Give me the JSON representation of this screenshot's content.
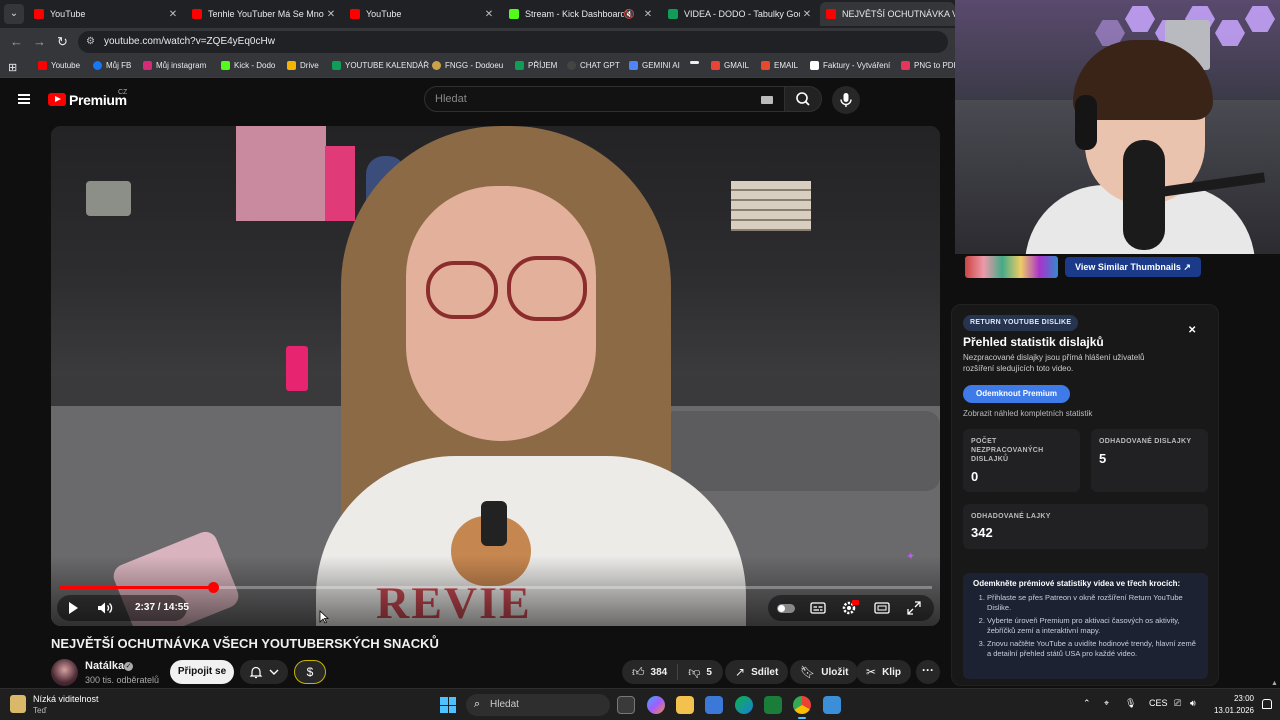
{
  "browser": {
    "tabs": [
      {
        "label": "YouTube",
        "active": false
      },
      {
        "label": "Tenhle YouTuber Má Se Mnou Problém",
        "active": false
      },
      {
        "label": "YouTube",
        "active": false
      },
      {
        "label": "Stream - Kick Dashboard",
        "active": false
      },
      {
        "label": "VIDEA - DODO - Tabulky Google",
        "active": false
      },
      {
        "label": "NEJVĚTŠÍ OCHUTNÁVKA VŠECH",
        "active": true
      }
    ],
    "url": "youtube.com/watch?v=ZQE4yEq0cHw",
    "bookmarks": [
      {
        "label": "Youtube",
        "color": "#ff0000"
      },
      {
        "label": "Můj FB",
        "color": "#1877f2"
      },
      {
        "label": "Můj instagram",
        "color": "#d62976"
      },
      {
        "label": "Kick - Dodo",
        "color": "#53fc18"
      },
      {
        "label": "Drive",
        "color": "#f4b400"
      },
      {
        "label": "YOUTUBE KALENDÁŘ",
        "color": "#0f9d58"
      },
      {
        "label": "FNGG - Dodoeu",
        "color": "#caa24a"
      },
      {
        "label": "PŘÍJEM",
        "color": "#0f9d58"
      },
      {
        "label": "CHAT GPT",
        "color": "#444444"
      },
      {
        "label": "GEMINI AI",
        "color": "#4f86f7"
      },
      {
        "label": "",
        "color": "#eeeeee"
      },
      {
        "label": "GMAIL",
        "color": "#ea4335"
      },
      {
        "label": "EMAIL",
        "color": "#e8482c"
      },
      {
        "label": "Faktury - Vytváření",
        "color": "#ffffff"
      },
      {
        "label": "PNG to PDF",
        "color": "#e8335d"
      }
    ]
  },
  "youtube": {
    "logo_text": "Premium",
    "country": "CZ",
    "search_placeholder": "Hledat",
    "player": {
      "time": "2:37 / 14:55",
      "progress": 0.176
    },
    "video_title": "NEJVĚTŠÍ OCHUTNÁVKA VŠECH YOUTUBERSKÝCH SNACKŮ",
    "channel": {
      "name": "Natálka",
      "verified": "✓",
      "subscribers": "300 tis. odběratelů",
      "join_label": "Připojit se"
    },
    "actions": {
      "likes": "384",
      "dislikes": "5",
      "share": "Sdílet",
      "save": "Uložit",
      "clip": "Klip"
    },
    "similar_thumbnails_label": "View Similar Thumbnails ↗"
  },
  "ryd_panel": {
    "badge": "RETURN YOUTUBE DISLIKE",
    "title": "Přehled statistik dislajků",
    "description": "Nezpracované dislajky jsou přímá hlášení uživatelů rozšíření sledujících toto video.",
    "unlock_label": "Odemknout Premium",
    "preview_label": "Zobrazit náhled kompletních statistik",
    "stats": {
      "raw_label": "POČET NEZPRACOVANÝCH DISLAJKŮ",
      "raw_value": "0",
      "est_dislikes_label": "ODHADOVANÉ DISLAJKY",
      "est_dislikes_value": "5",
      "est_likes_label": "ODHADOVANÉ LAJKY",
      "est_likes_value": "342"
    },
    "steps_heading": "Odemkněte prémiové statistiky videa ve třech krocích:",
    "steps": [
      "Přihlaste se přes Patreon v okně rozšíření Return YouTube Dislike.",
      "Vyberte úroveň Premium pro aktivaci časových os aktivity, žebříčků zemí a interaktivní mapy.",
      "Znovu načtěte YouTube a uvidíte hodinové trendy, hlavní země a detailní přehled států USA pro každé video."
    ]
  },
  "taskbar": {
    "weather_title": "Nízká viditelnost",
    "weather_sub": "Teď",
    "search_placeholder": "Hledat",
    "language": "CES",
    "time": "23:00",
    "date": "13.01.2026"
  },
  "colors": {
    "yt_red": "#ff0000",
    "ryd_blue": "#3e7be8",
    "accent_windows": "#4cc2ff"
  }
}
